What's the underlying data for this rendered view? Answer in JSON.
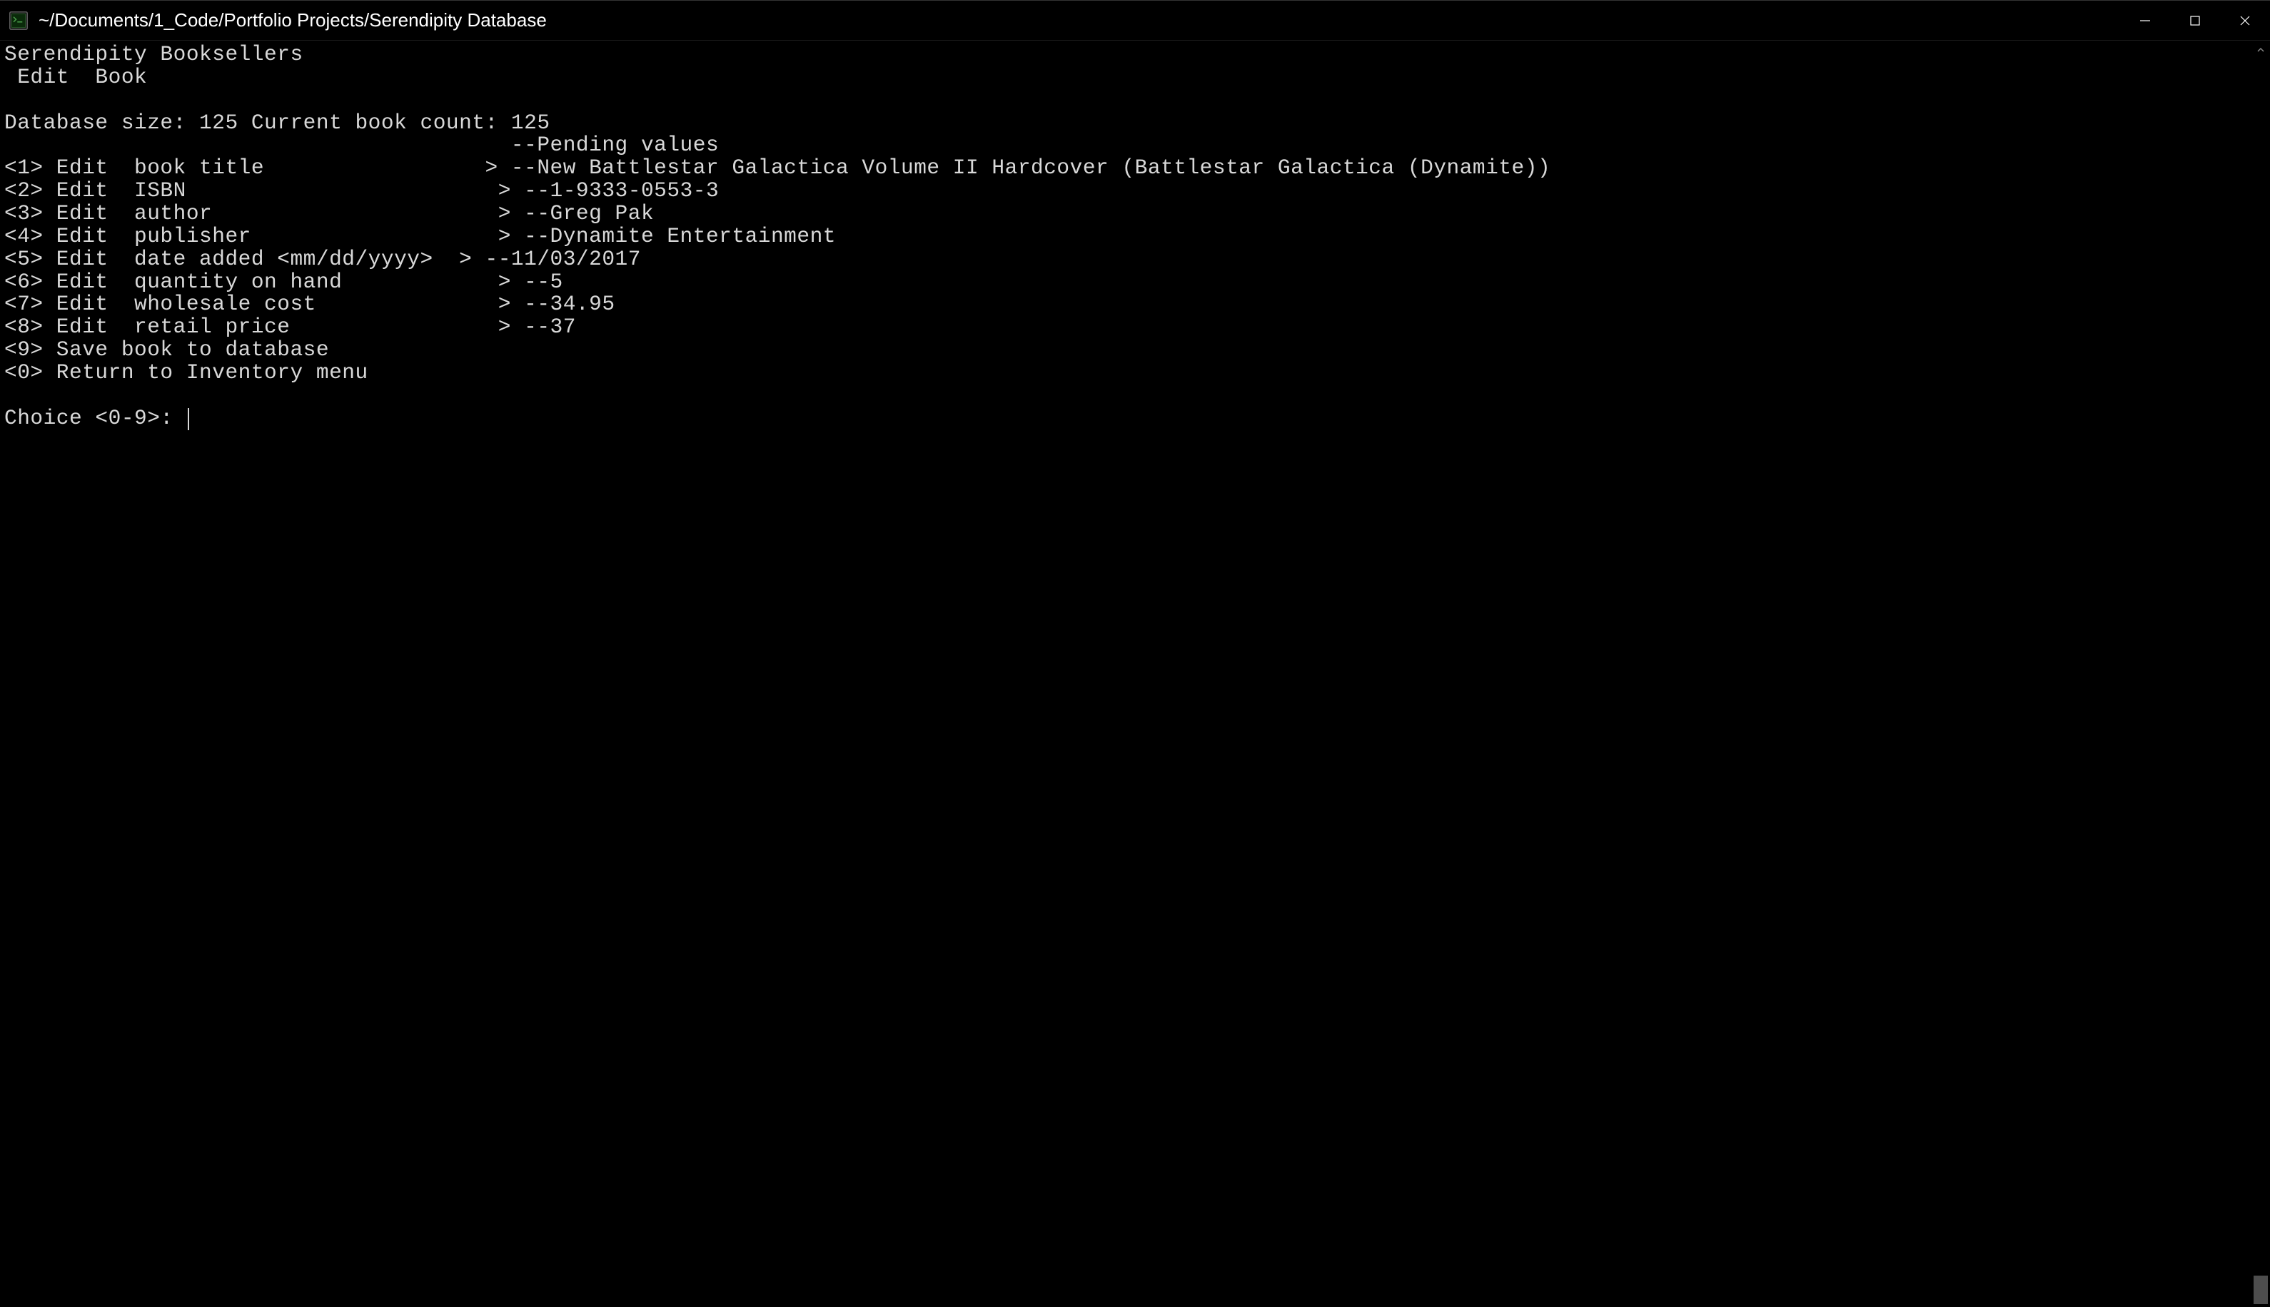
{
  "window": {
    "title": "~/Documents/1_Code/Portfolio Projects/Serendipity Database"
  },
  "app": {
    "header_line1": "Serendipity Booksellers",
    "header_line2": " Edit  Book",
    "db_info": "Database size: 125 Current book count: 125",
    "pending_header": "                                       --Pending values",
    "menu": [
      {
        "n": "1",
        "label": "Edit  book title                 >",
        "value": "New Battlestar Galactica Volume II Hardcover (Battlestar Galactica (Dynamite))"
      },
      {
        "n": "2",
        "label": "Edit  ISBN                        >",
        "value": "1-9333-0553-3"
      },
      {
        "n": "3",
        "label": "Edit  author                      >",
        "value": "Greg Pak"
      },
      {
        "n": "4",
        "label": "Edit  publisher                   >",
        "value": "Dynamite Entertainment"
      },
      {
        "n": "5",
        "label": "Edit  date added <mm/dd/yyyy>  >",
        "value": "11/03/2017"
      },
      {
        "n": "6",
        "label": "Edit  quantity on hand            >",
        "value": "5"
      },
      {
        "n": "7",
        "label": "Edit  wholesale cost              >",
        "value": "34.95"
      },
      {
        "n": "8",
        "label": "Edit  retail price                >",
        "value": "37"
      },
      {
        "n": "9",
        "label": "Save book to database",
        "value": null
      },
      {
        "n": "0",
        "label": "Return to Inventory menu",
        "value": null
      }
    ],
    "prompt": "Choice <0-9>: "
  }
}
